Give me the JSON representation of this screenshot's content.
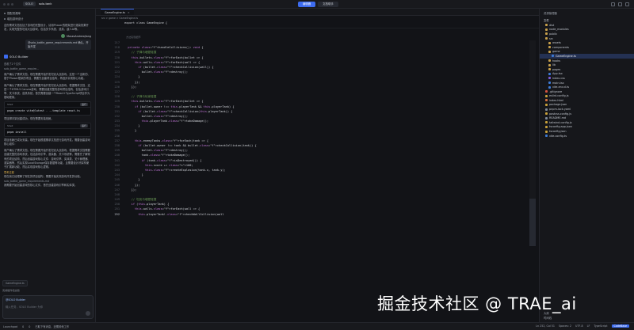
{
  "titlebar": {
    "left_chip": "SOLO",
    "project": "solo-tank",
    "modes": [
      "编辑器",
      "文档助手"
    ],
    "active_mode": 0
  },
  "chat": {
    "top_items": [
      "搭配资源库",
      "增加游戏设计"
    ],
    "intro_paragraph": "这份需求文档包括了游戏的完整设计，请用Phaser的框架进行渲染效果开发，实现完整的坦克大战游戏，包括关卡系统、道具、敌人AI等。",
    "user_name": "MosesAndrewJiang",
    "user_message": "@solo_battle_game_requirements.md 确认，开始开发",
    "bot_name": "SOLO Builder",
    "tool_1": "查看了2个文件",
    "tool_1_file": "solo_battle_game_require…",
    "para_1": "用户确认了需求文档，现在需要开始开发坦克大战游戏，这是一个全新的、基于Phaser框架的项目，需要先创建项目结构，再逐步实现核心功能。",
    "para_2": "用户确认了需求文档，现在需要开始开发坦克大战游戏，根据需求文档，这是一个HTML5 Canvas游戏，需要创建完整的游戏项目结构，包括游戏引擎、关卡系统、道具系统，首先需要创建一个React+TypeScript项目作为基础框架。",
    "code_1_lang": "Shell",
    "code_1_run": "运行",
    "code_1_body": "pnpm create vite@latest . --template react-ts",
    "para_3": "项目脚手架创建成功，现在需要安装依赖。",
    "code_2_lang": "Shell",
    "code_2_run": "运行",
    "code_2_body": "pnpm install",
    "para_4": "项目依赖已成功安装，现在开始根据需求文档进行游戏开发。需要创建游戏核心组件：",
    "para_5": "用户确认了需求文档，现在需要开始开发坦克大战游戏，根据需求文档需要创建完整的游戏系统，包括游戏引擎、渲染器、关卡系统等，需要先了解现有的项目结构，然后创建游戏核心文件：游戏引擎、实体类、关卡管理器、渲染器等，然后实现LocalStorage保存数据等功能，且需要设计好架构便于扩展新功能，然后实现游戏核心逻辑。",
    "tool_2": "思考过程",
    "para_6": "现在我已经理解了现在的项目结构，需要开始实现游戏开发的功能。",
    "tool_3": "solo_battle_game_requirements.md",
    "para_7": "我需要开始创建游戏的核心文件，首先创建游戏引擎和实体类。",
    "ctx_chip": "GameEngine.ts",
    "ctx_line": "完成组件和文档",
    "input_tag": "@SOLO Builder",
    "input_placeholder": "输入任务，SOLO Builder 为你"
  },
  "editor": {
    "tab_label": "GameEngine.ts",
    "breadcrumb": "src > game > GameEngine.ts",
    "phase_label": "方法实现细节",
    "sticky_line": "export class GameEngine {",
    "lines": [
      {
        "n": "217",
        "t": ""
      },
      {
        "n": "218",
        "t": "  private handleCollisions(): void {"
      },
      {
        "n": "219",
        "t": "    // 子弹与墙壁碰撞"
      },
      {
        "n": "220",
        "t": "    this.bullets.forEach(bullet => {"
      },
      {
        "n": "221",
        "t": "      this.walls.forEach(wall => {"
      },
      {
        "n": "222",
        "t": "        if (bullet.checkCollision(wall)) {"
      },
      {
        "n": "223",
        "t": "          bullet.destroy();"
      },
      {
        "n": "224",
        "t": "        }"
      },
      {
        "n": "225",
        "t": "      });"
      },
      {
        "n": "226",
        "t": "    });"
      },
      {
        "n": "227",
        "t": ""
      },
      {
        "n": "228",
        "t": "    // 子弹与玩家碰撞"
      },
      {
        "n": "229",
        "t": "    this.bullets.forEach(bullet => {"
      },
      {
        "n": "230",
        "t": "      if (bullet.owner !== this.playerTank && this.playerTank) {"
      },
      {
        "n": "231",
        "t": "        if (bullet.checkCollision(this.playerTank)) {"
      },
      {
        "n": "232",
        "t": "          bullet.destroy();"
      },
      {
        "n": "233",
        "t": "          this.playerTank.takeDamage();"
      },
      {
        "n": "234",
        "t": "        }"
      },
      {
        "n": "235",
        "t": "      }"
      },
      {
        "n": "236",
        "t": ""
      },
      {
        "n": "237",
        "t": "      this.enemyTanks.forEach(tank => {"
      },
      {
        "n": "238",
        "t": "        if (bullet.owner !== tank && bullet.checkCollision(tank)) {"
      },
      {
        "n": "239",
        "t": "          bullet.destroy();"
      },
      {
        "n": "240",
        "t": "          tank.takeDamage();"
      },
      {
        "n": "241",
        "t": "          if (tank.isDestroyed()) {"
      },
      {
        "n": "242",
        "t": "            this.score += 100;"
      },
      {
        "n": "243",
        "t": "            this.createExplosion(tank.x, tank.y);"
      },
      {
        "n": "244",
        "t": "          }"
      },
      {
        "n": "245",
        "t": "        }"
      },
      {
        "n": "246",
        "t": "      });"
      },
      {
        "n": "247",
        "t": "    });"
      },
      {
        "n": "248",
        "t": ""
      },
      {
        "n": "249",
        "t": "    // 坦克与墙壁碰撞"
      },
      {
        "n": "250",
        "t": "    if (this.playerTank) {"
      },
      {
        "n": "251",
        "t": "      this.walls.forEach(wall => {"
      },
      {
        "n": "252",
        "t": "        this.playerTank!.checkWallCollision(wall"
      }
    ]
  },
  "explorer": {
    "header": "资源管理器",
    "root": "文件",
    "items": [
      {
        "label": "dist",
        "kind": "folder",
        "depth": 1
      },
      {
        "label": "node_modules",
        "kind": "folder",
        "depth": 1
      },
      {
        "label": "public",
        "kind": "folder",
        "depth": 1
      },
      {
        "label": "src",
        "kind": "folder",
        "depth": 1
      },
      {
        "label": "assets",
        "kind": "folder",
        "depth": 2
      },
      {
        "label": "components",
        "kind": "folder",
        "depth": 2
      },
      {
        "label": "game",
        "kind": "folder",
        "depth": 2
      },
      {
        "label": "GameEngine.ts",
        "kind": "ts",
        "depth": 3,
        "active": true
      },
      {
        "label": "hooks",
        "kind": "folder",
        "depth": 2
      },
      {
        "label": "lib",
        "kind": "folder",
        "depth": 2
      },
      {
        "label": "pages",
        "kind": "folder",
        "depth": 2
      },
      {
        "label": "App.tsx",
        "kind": "ts",
        "depth": 2
      },
      {
        "label": "index.css",
        "kind": "css",
        "depth": 2
      },
      {
        "label": "main.tsx",
        "kind": "ts",
        "depth": 2
      },
      {
        "label": "vite-env.d.ts",
        "kind": "ts",
        "depth": 2
      },
      {
        "label": ".gitignore",
        "kind": "git",
        "depth": 1
      },
      {
        "label": "eslint.config.js",
        "kind": "json",
        "depth": 1
      },
      {
        "label": "index.html",
        "kind": "html",
        "depth": 1
      },
      {
        "label": "package.json",
        "kind": "json",
        "depth": 1
      },
      {
        "label": "pnpm-lock.yaml",
        "kind": "md",
        "depth": 1
      },
      {
        "label": "postcss.config.js",
        "kind": "json",
        "depth": 1
      },
      {
        "label": "README.md",
        "kind": "md",
        "depth": 1
      },
      {
        "label": "tailwind.config.js",
        "kind": "json",
        "depth": 1
      },
      {
        "label": "tsconfig.app.json",
        "kind": "json",
        "depth": 1
      },
      {
        "label": "tsconfig.json",
        "kind": "json",
        "depth": 1
      },
      {
        "label": "vite.config.ts",
        "kind": "ts",
        "depth": 1
      }
    ],
    "bottom_1": "大纲",
    "bottom_2": "时间线"
  },
  "statusbar": {
    "left": [
      "Launchpad",
      "0",
      "0",
      "已取下有消息，还需其他工作"
    ],
    "right": [
      "Ln 252, Col 51",
      "Spaces: 2",
      "UTF-8",
      "LF",
      "TypeScript",
      "CodeBase"
    ]
  },
  "watermark": "掘金技术社区 @ TRAE_ai"
}
